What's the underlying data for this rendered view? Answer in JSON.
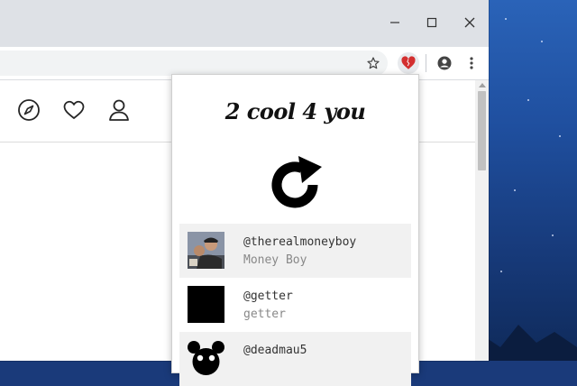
{
  "popup": {
    "title": "2 cool 4 you",
    "refresh_icon": "refresh-icon",
    "users": [
      {
        "handle": "@therealmoneyboy",
        "name": "Money Boy",
        "avatar": "photo"
      },
      {
        "handle": "@getter",
        "name": "getter",
        "avatar": "black-square"
      },
      {
        "handle": "@deadmau5",
        "name": "",
        "avatar": "mau5head"
      }
    ]
  },
  "toolbar": {
    "icons": [
      "star-icon",
      "extension-heart-icon",
      "account-icon",
      "menu-icon"
    ]
  },
  "window_controls": [
    "minimize-icon",
    "maximize-icon",
    "close-icon"
  ],
  "nav_icons": [
    "explore-icon",
    "heart-icon",
    "profile-icon"
  ],
  "colors": {
    "heart": "#d32f2f",
    "popup_row_bg": "#f1f1f1",
    "desktop_bg": "#1f4f9f"
  }
}
